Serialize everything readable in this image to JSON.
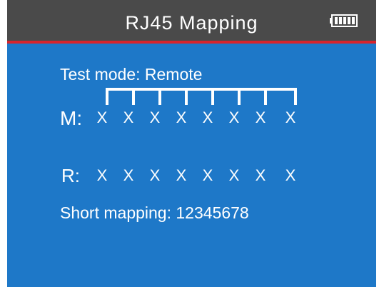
{
  "header": {
    "title": "RJ45  Mapping",
    "battery_icon": "battery-full-icon"
  },
  "main": {
    "test_mode": "Test mode: Remote",
    "m_label": "M:",
    "m_pins": [
      "X",
      "X",
      "X",
      "X",
      "X",
      "X",
      "X",
      "X"
    ],
    "r_label": "R:",
    "r_pins": [
      "X",
      "X",
      "X",
      "X",
      "X",
      "X",
      "X",
      "X"
    ],
    "short_mapping": "Short mapping: 12345678"
  },
  "colors": {
    "header_bg": "#4a4a4a",
    "accent_line": "#d8242c",
    "screen_bg": "#1e78c8",
    "text": "#ffffff"
  }
}
